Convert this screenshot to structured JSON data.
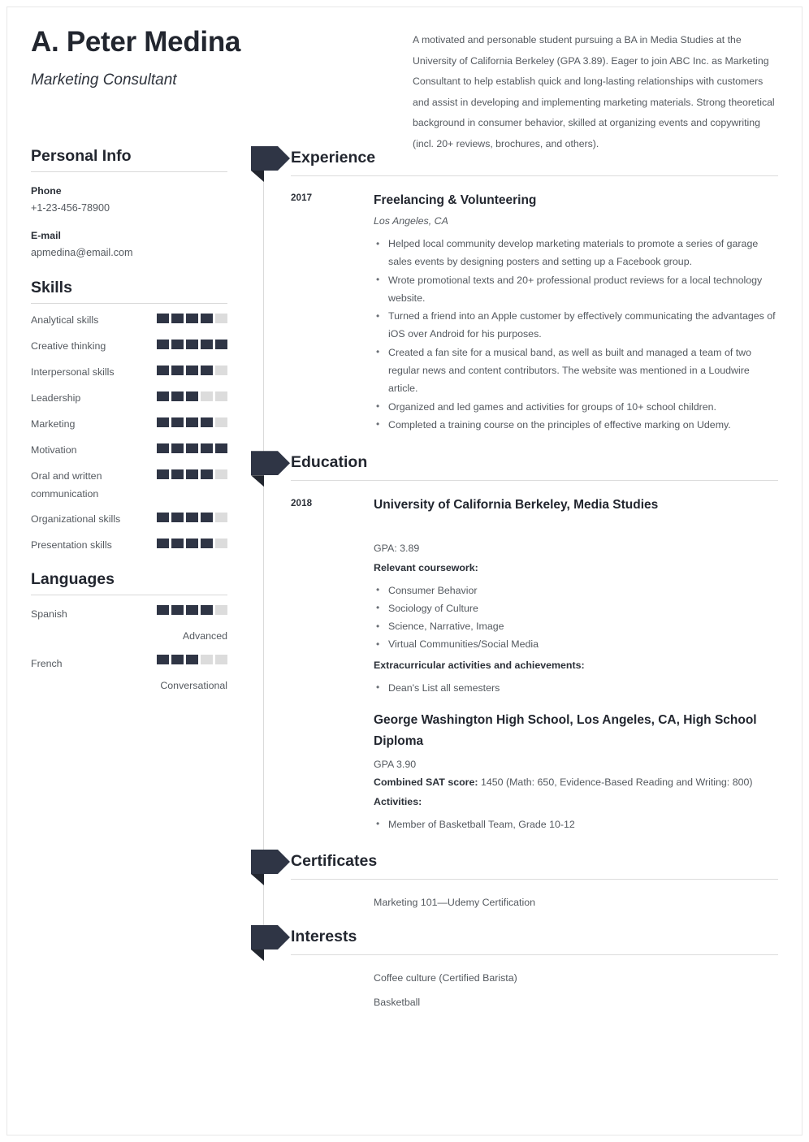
{
  "header": {
    "name": "A. Peter Medina",
    "job_title": "Marketing Consultant",
    "summary": "A motivated and personable student pursuing a BA in Media Studies at the University of California Berkeley (GPA 3.89). Eager to join ABC Inc. as Marketing Consultant to help establish quick and long-lasting relationships with customers and assist in developing and implementing marketing materials. Strong theoretical background in consumer behavior, skilled at organizing events and copywriting (incl. 20+ reviews, brochures, and others)."
  },
  "colors": {
    "filled_square": "#2f3545",
    "empty_square": "#dcdcdc",
    "heading": "#22262f",
    "body_text": "#54595f"
  },
  "sidebar": {
    "personal_info": {
      "heading": "Personal Info",
      "fields": [
        {
          "label": "Phone",
          "value": "+1-23-456-78900"
        },
        {
          "label": "E-mail",
          "value": "apmedina@email.com"
        }
      ]
    },
    "skills": {
      "heading": "Skills",
      "max": 5,
      "items": [
        {
          "label": "Analytical skills",
          "level": 4
        },
        {
          "label": "Creative thinking",
          "level": 5
        },
        {
          "label": "Interpersonal skills",
          "level": 4
        },
        {
          "label": "Leadership",
          "level": 3
        },
        {
          "label": "Marketing",
          "level": 4
        },
        {
          "label": "Motivation",
          "level": 5
        },
        {
          "label": "Oral and written communication",
          "level": 4
        },
        {
          "label": "Organizational skills",
          "level": 4
        },
        {
          "label": "Presentation skills",
          "level": 4
        }
      ]
    },
    "languages": {
      "heading": "Languages",
      "max": 5,
      "items": [
        {
          "label": "Spanish",
          "level": 4,
          "proficiency": "Advanced"
        },
        {
          "label": "French",
          "level": 3,
          "proficiency": "Conversational"
        }
      ]
    }
  },
  "main": {
    "experience": {
      "heading": "Experience",
      "entries": [
        {
          "date": "2017",
          "title": "Freelancing & Volunteering",
          "location": "Los Angeles, CA",
          "bullets": [
            "Helped local community develop marketing materials to promote a series of garage sales events by designing posters and setting up a Facebook group.",
            "Wrote promotional texts and 20+ professional product reviews for a local technology website.",
            "Turned a friend into an Apple customer by effectively communicating the advantages of iOS over Android for his purposes.",
            "Created a fan site for a musical band, as well as built and managed a team of two regular news and content contributors. The website was mentioned in a Loudwire article.",
            "Organized and led games and activities for groups of 10+ school children.",
            "Completed a training course on the principles of effective marking on Udemy."
          ]
        }
      ]
    },
    "education": {
      "heading": "Education",
      "university": {
        "date": "2018",
        "title": "University of California Berkeley, Media Studies",
        "gpa": "GPA: 3.89",
        "coursework_label": "Relevant coursework:",
        "coursework": [
          "Consumer Behavior",
          "Sociology of Culture",
          "Science, Narrative, Image",
          "Virtual Communities/Social Media"
        ],
        "extracurricular_label": "Extracurricular activities and achievements:",
        "extracurricular": [
          "Dean's List all semesters"
        ]
      },
      "high_school": {
        "title": "George Washington High School, Los Angeles, CA, High School Diploma",
        "gpa": "GPA 3.90",
        "sat_label": "Combined SAT score:",
        "sat_value": "1450 (Math: 650, Evidence-Based Reading and Writing: 800)",
        "activities_label": "Activities:",
        "activities": [
          "Member of Basketball Team, Grade 10-12"
        ]
      }
    },
    "certificates": {
      "heading": "Certificates",
      "items": [
        "Marketing 101—Udemy Certification"
      ]
    },
    "interests": {
      "heading": "Interests",
      "items": [
        "Coffee culture (Certified Barista)",
        "Basketball"
      ]
    }
  }
}
